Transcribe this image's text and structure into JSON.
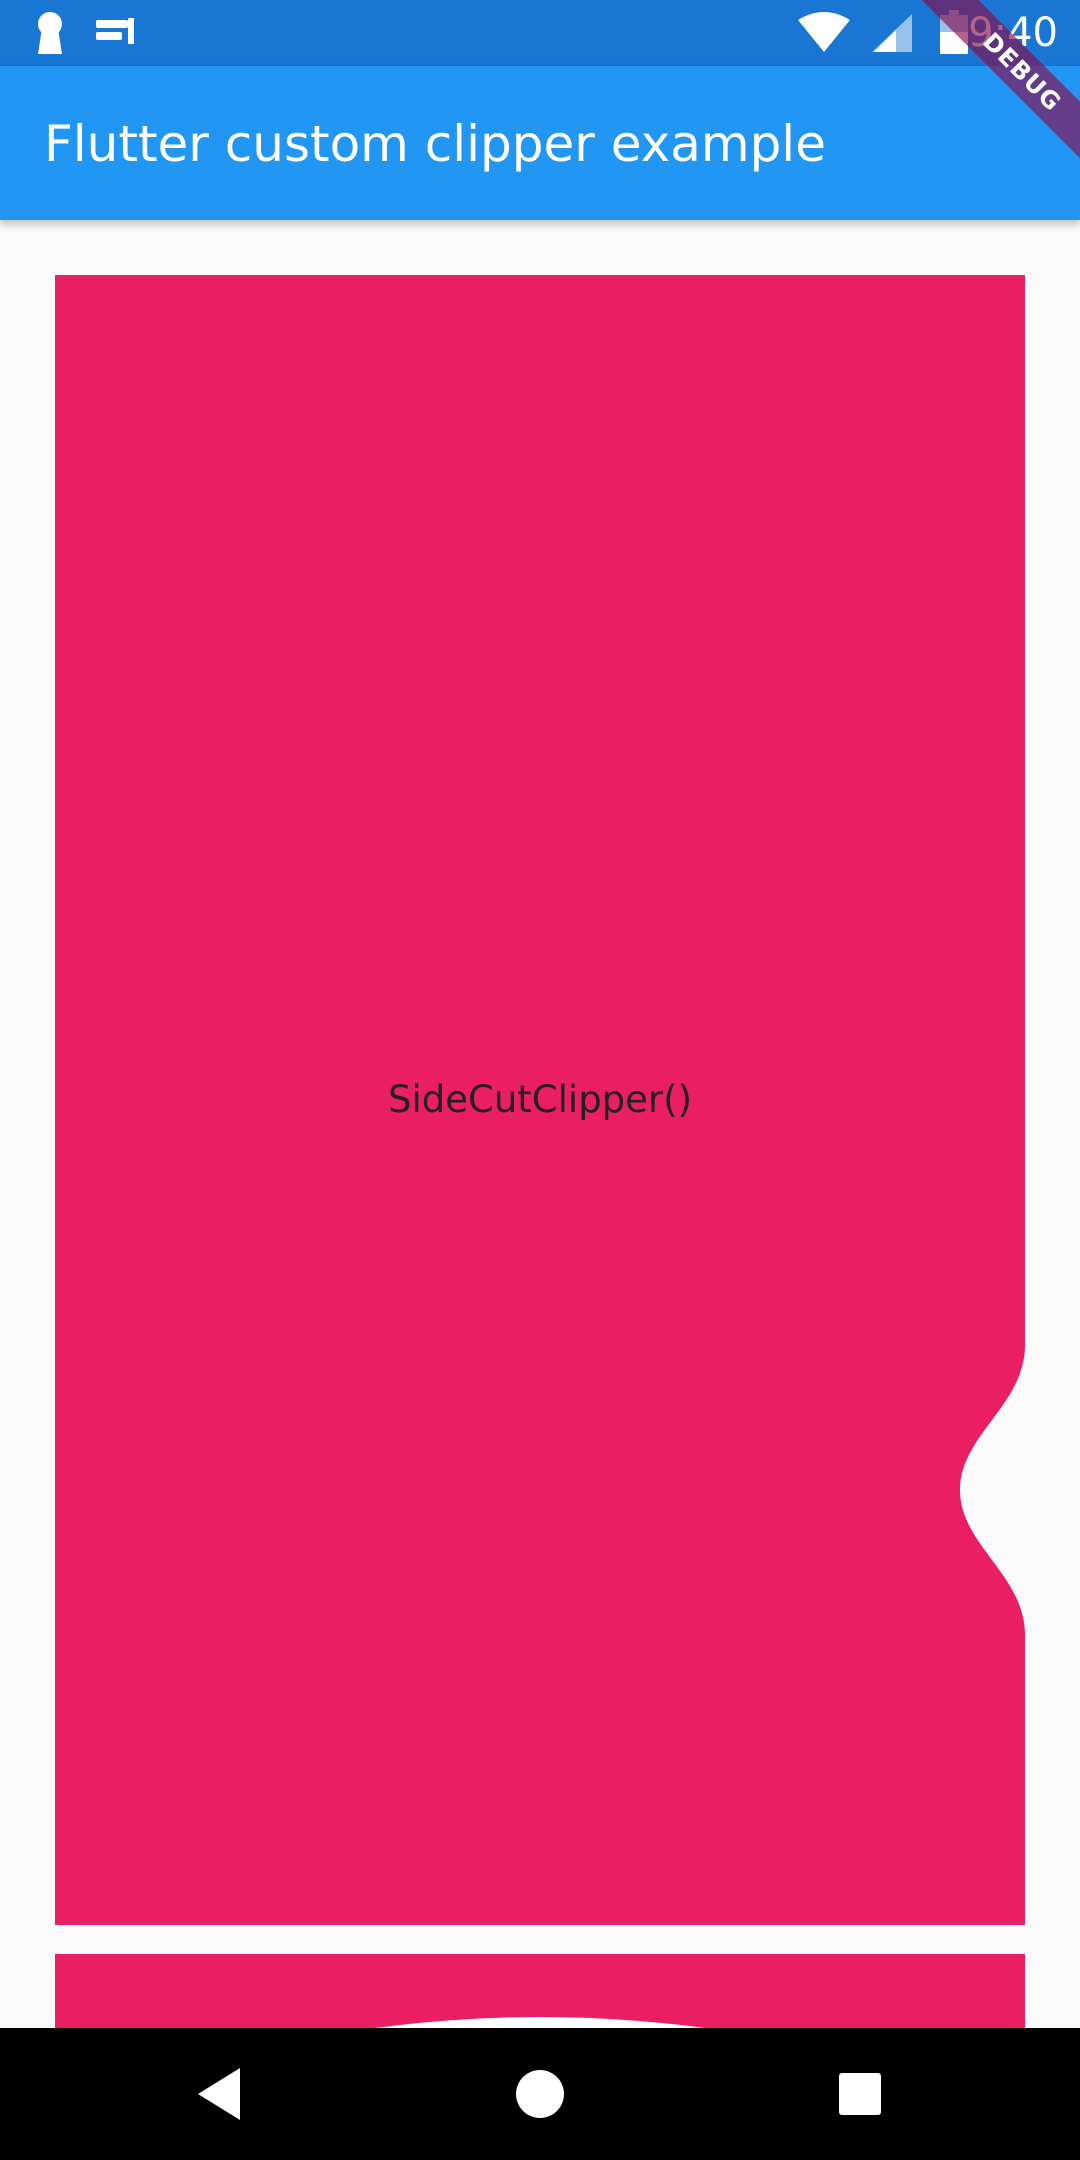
{
  "status_bar": {
    "time": "9:40",
    "left_icons": [
      "keyhole-notification-icon",
      "app-logo-notification-icon"
    ],
    "right_icons": [
      "wifi-icon",
      "cell-signal-icon",
      "battery-icon"
    ],
    "color": "#1976d2"
  },
  "app_bar": {
    "title": "Flutter custom clipper example",
    "color": "#2196f3"
  },
  "debug_banner": {
    "label": "DEBUG"
  },
  "cards": [
    {
      "label": "SideCutClipper()",
      "color": "#e91e63"
    },
    {
      "label": "",
      "color": "#e91e63"
    }
  ],
  "nav_bar": {
    "buttons": [
      "back-icon",
      "home-icon",
      "recents-icon"
    ]
  }
}
